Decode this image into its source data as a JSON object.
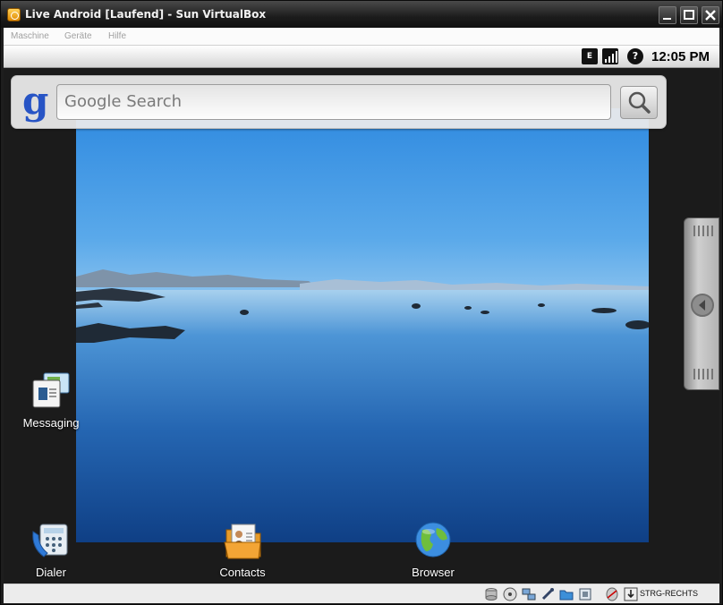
{
  "window": {
    "title": "Live Android [Laufend] - Sun VirtualBox"
  },
  "menu": {
    "items": [
      "Maschine",
      "Geräte",
      "Hilfe"
    ]
  },
  "statusbar": {
    "time": "12:05 PM",
    "icons": [
      "e-icon",
      "signal-icon",
      "question-icon"
    ]
  },
  "search": {
    "placeholder": "Google Search",
    "logo": "g"
  },
  "apps": {
    "messaging": "Messaging",
    "dialer": "Dialer",
    "contacts": "Contacts",
    "browser": "Browser"
  },
  "vbox_status": {
    "host_key": "STRG-RECHTS"
  }
}
